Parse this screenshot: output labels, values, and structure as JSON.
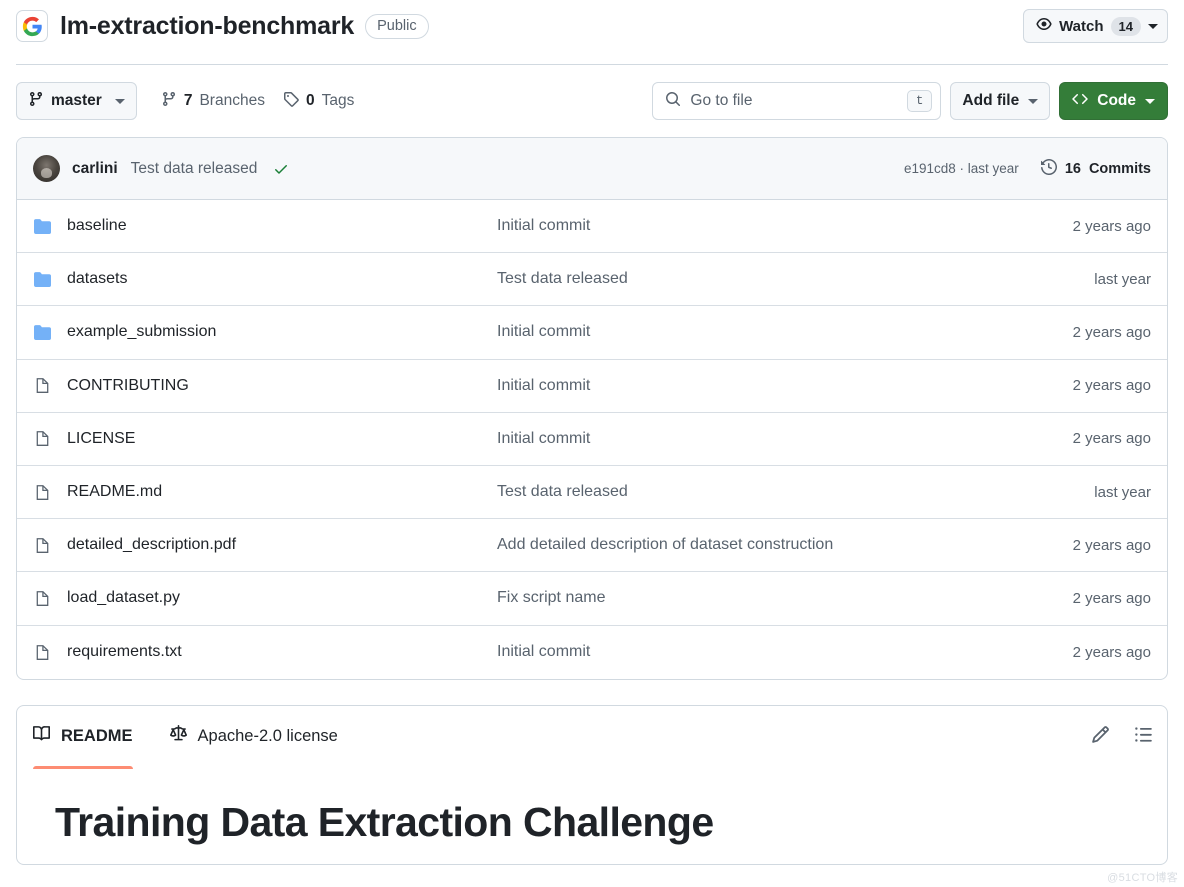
{
  "header": {
    "owner_logo_icon": "google-g-logo",
    "repo_name": "lm-extraction-benchmark",
    "visibility": "Public",
    "watch": {
      "icon": "eye-icon",
      "label": "Watch",
      "count": "14",
      "caret_icon": "chevron-down-icon"
    }
  },
  "toolbar": {
    "branch": {
      "icon": "git-branch-icon",
      "label": "master",
      "caret_icon": "chevron-down-icon"
    },
    "branches_link": {
      "icon": "git-branch-icon",
      "count": "7",
      "label": "Branches"
    },
    "tags_link": {
      "icon": "tag-icon",
      "count": "0",
      "label": "Tags"
    },
    "search": {
      "icon": "search-icon",
      "placeholder": "Go to file",
      "value": "",
      "kbd_hint": "t"
    },
    "add_file": {
      "label": "Add file",
      "caret_icon": "chevron-down-icon"
    },
    "code": {
      "icon": "code-brackets-icon",
      "label": "Code",
      "caret_icon": "chevron-down-icon",
      "color": "#347d39"
    }
  },
  "commit_bar": {
    "avatar_alt": "carlini",
    "author": "carlini",
    "message": "Test data released",
    "status_icon": "check-icon",
    "status_color": "#1a7f37",
    "hash_and_time": "e191cd8 · last year",
    "history_icon": "history-icon",
    "commits_count": "16",
    "commits_label": "Commits"
  },
  "files": {
    "rows": [
      {
        "icon": "folder-icon",
        "type": "folder",
        "name": "baseline",
        "message": "Initial commit",
        "age": "2 years ago"
      },
      {
        "icon": "folder-icon",
        "type": "folder",
        "name": "datasets",
        "message": "Test data released",
        "age": "last year"
      },
      {
        "icon": "folder-icon",
        "type": "folder",
        "name": "example_submission",
        "message": "Initial commit",
        "age": "2 years ago"
      },
      {
        "icon": "file-icon",
        "type": "file",
        "name": "CONTRIBUTING",
        "message": "Initial commit",
        "age": "2 years ago"
      },
      {
        "icon": "file-icon",
        "type": "file",
        "name": "LICENSE",
        "message": "Initial commit",
        "age": "2 years ago"
      },
      {
        "icon": "file-icon",
        "type": "file",
        "name": "README.md",
        "message": "Test data released",
        "age": "last year"
      },
      {
        "icon": "file-icon",
        "type": "file",
        "name": "detailed_description.pdf",
        "message": "Add detailed description of dataset construction",
        "age": "2 years ago"
      },
      {
        "icon": "file-icon",
        "type": "file",
        "name": "load_dataset.py",
        "message": "Fix script name",
        "age": "2 years ago"
      },
      {
        "icon": "file-icon",
        "type": "file",
        "name": "requirements.txt",
        "message": "Initial commit",
        "age": "2 years ago"
      }
    ]
  },
  "readme": {
    "tabs": [
      {
        "icon": "book-icon",
        "label": "README",
        "active": true
      },
      {
        "icon": "law-scales-icon",
        "label": "Apache-2.0 license",
        "active": false
      }
    ],
    "edit_icon": "pencil-icon",
    "outline_icon": "list-unordered-icon",
    "active_underline_color": "#fd8c73",
    "heading": "Training Data Extraction Challenge"
  },
  "watermark": "@51CTO博客"
}
